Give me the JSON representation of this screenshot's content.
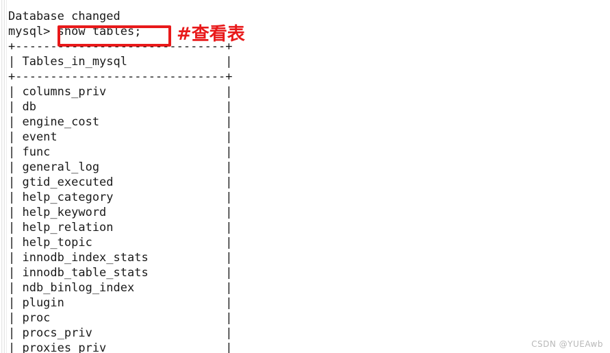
{
  "terminal": {
    "database_changed_line": "Database changed",
    "prompt": "mysql> ",
    "command": "show tables;",
    "prompt_line": "mysql> show tables;",
    "rule_top": "+------------------------------+",
    "rule_middle": "+------------------------------+",
    "column_header": "| Tables_in_mysql              |",
    "column_header_name": "Tables_in_mysql",
    "row_prefix": "| ",
    "row_suffix": "|",
    "rows": [
      "columns_priv",
      "db",
      "engine_cost",
      "event",
      "func",
      "general_log",
      "gtid_executed",
      "help_category",
      "help_keyword",
      "help_relation",
      "help_topic",
      "innodb_index_stats",
      "innodb_table_stats",
      "ndb_binlog_index",
      "plugin",
      "proc",
      "procs_priv",
      "proxies_priv"
    ]
  },
  "annotation": {
    "note_text": "#查看表",
    "highlight_color": "#e8191a",
    "highlighted_command": "show tables;"
  },
  "watermark": {
    "text": "CSDN @YUEAwb"
  }
}
